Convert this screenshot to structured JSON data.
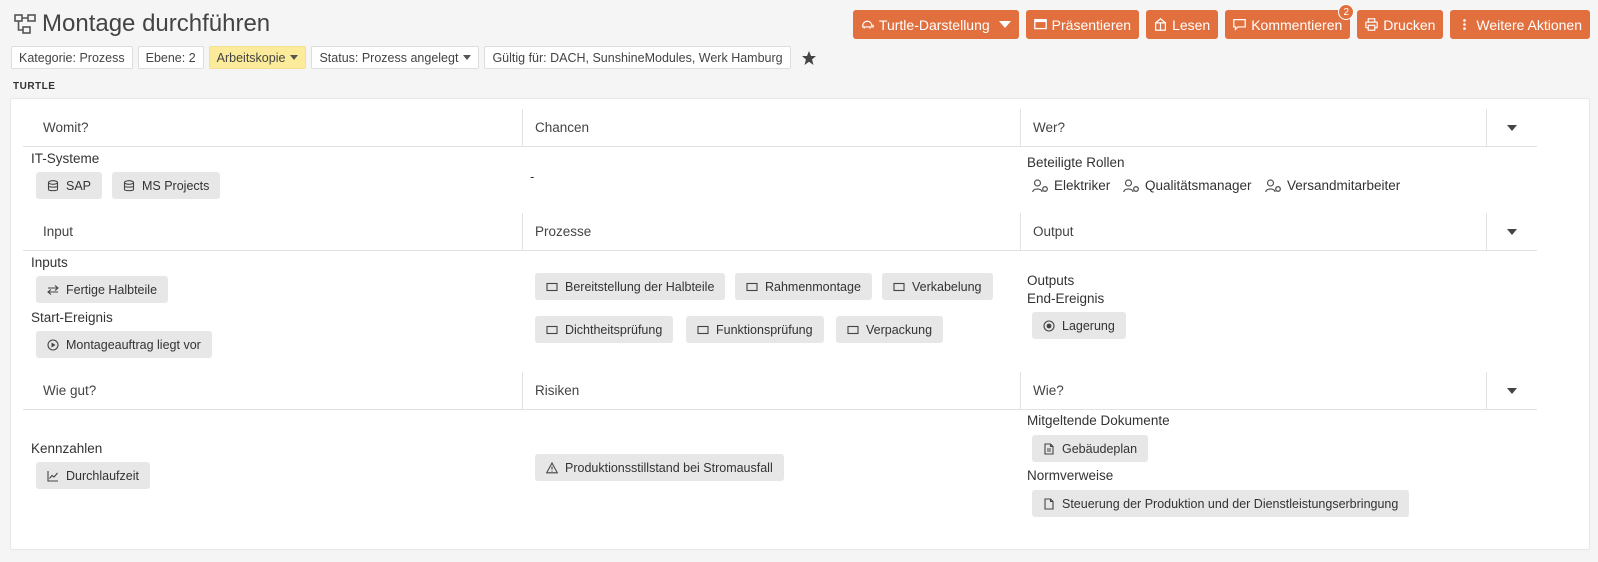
{
  "header": {
    "title": "Montage durchführen",
    "actions": [
      {
        "label": "Turtle-Darstellung",
        "icon": "turtle-icon"
      },
      {
        "label": "Präsentieren",
        "icon": "presentation-icon"
      },
      {
        "label": "Lesen",
        "icon": "read-icon"
      },
      {
        "label": "Kommentieren",
        "icon": "comment-icon",
        "badge": "2"
      },
      {
        "label": "Drucken",
        "icon": "printer-icon"
      },
      {
        "label": "Weitere Aktionen",
        "icon": "more-vertical-icon"
      }
    ]
  },
  "tags": {
    "kategorie": "Kategorie: Prozess",
    "ebene": "Ebene: 2",
    "arbeitskopie": "Arbeitskopie",
    "status": "Status: Prozess angelegt",
    "gueltig": "Gültig für: DACH, SunshineModules, Werk Hamburg"
  },
  "section_label": "TURTLE",
  "turtle": {
    "row1": {
      "headers": [
        "Womit?",
        "Chancen",
        "Wer?"
      ],
      "it_label": "IT-Systeme",
      "it_systems": [
        "SAP",
        "MS Projects"
      ],
      "chancen": "-",
      "roles_label": "Beteiligte Rollen",
      "roles": [
        "Elektriker",
        "Qualitätsmanager",
        "Versandmitarbeiter"
      ]
    },
    "row2": {
      "headers": [
        "Input",
        "Prozesse",
        "Output"
      ],
      "inputs_label": "Inputs",
      "inputs": [
        "Fertige Halbteile"
      ],
      "start_label": "Start-Ereignis",
      "start_events": [
        "Montageauftrag liegt vor"
      ],
      "processes": [
        "Bereitstellung der Halbteile",
        "Rahmenmontage",
        "Verkabelung",
        "Dichtheitsprüfung",
        "Funktionsprüfung",
        "Verpackung"
      ],
      "outputs_label": "Outputs",
      "end_label": "End-Ereignis",
      "end_events": [
        "Lagerung"
      ]
    },
    "row3": {
      "headers": [
        "Wie gut?",
        "Risiken",
        "Wie?"
      ],
      "kpi_label": "Kennzahlen",
      "kpis": [
        "Durchlaufzeit"
      ],
      "risks": [
        "Produktionsstillstand bei Stromausfall"
      ],
      "docs_label": "Mitgeltende Dokumente",
      "docs": [
        "Gebäudeplan"
      ],
      "norms_label": "Normverweise",
      "norms": [
        "Steuerung der Produktion und der Dienstleistungserbringung"
      ]
    }
  }
}
